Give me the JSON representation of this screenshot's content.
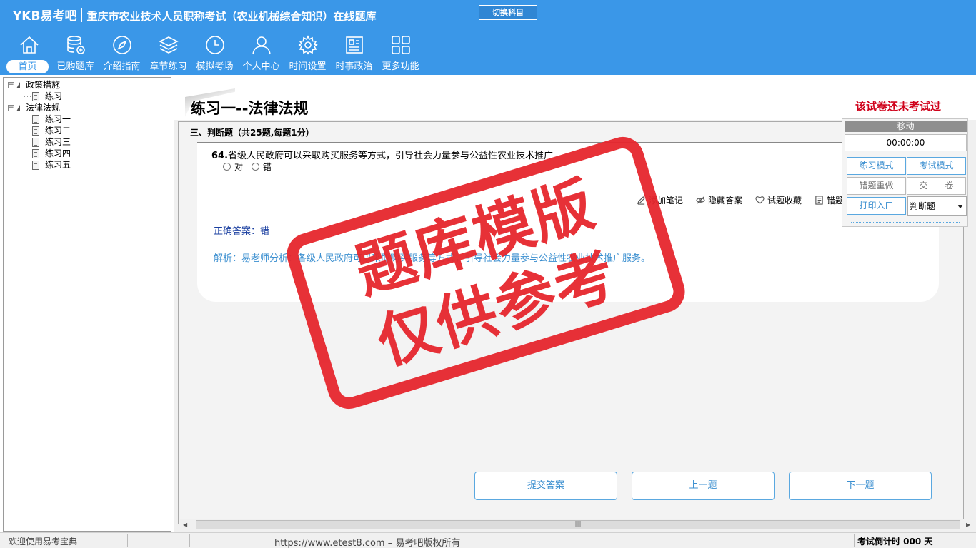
{
  "header": {
    "brand": "YKB易考吧",
    "title": "重庆市农业技术人员职称考试（农业机械综合知识）在线题库",
    "switch_label": "切换科目"
  },
  "nav": [
    {
      "label": "首页",
      "icon": "home-icon"
    },
    {
      "label": "已购题库",
      "icon": "database-icon"
    },
    {
      "label": "介绍指南",
      "icon": "compass-icon"
    },
    {
      "label": "章节练习",
      "icon": "layers-icon"
    },
    {
      "label": "模拟考场",
      "icon": "clock-icon"
    },
    {
      "label": "个人中心",
      "icon": "user-icon"
    },
    {
      "label": "时间设置",
      "icon": "gear-icon"
    },
    {
      "label": "时事政治",
      "icon": "news-icon"
    },
    {
      "label": "更多功能",
      "icon": "grid-icon"
    }
  ],
  "tree": {
    "groups": [
      {
        "label": "政策措施",
        "items": [
          "练习一"
        ]
      },
      {
        "label": "法律法规",
        "items": [
          "练习一",
          "练习二",
          "练习三",
          "练习四",
          "练习五"
        ]
      }
    ]
  },
  "main": {
    "heading": "练习一--法律法规",
    "exam_status": "该试卷还未考试过",
    "section_title": "三、判断题（共25题,每题1分）",
    "question": {
      "number": "64.",
      "text": "省级人民政府可以采取购买服务等方式，引导社会力量参与公益性农业技术推广",
      "options": [
        "对",
        "错"
      ],
      "tools": [
        "添加笔记",
        "隐藏答案",
        "试题收藏",
        "错题"
      ],
      "answer": "正确答案：错",
      "analysis": "解析：易老师分析：各级人民政府可以采取购买服务等方式，引导社会力量参与公益性农业技术推广服务。"
    },
    "buttons": {
      "submit": "提交答案",
      "prev": "上一题",
      "next": "下一题"
    }
  },
  "panel": {
    "move_label": "移动",
    "timer": "00:00:00",
    "practice_mode": "练习模式",
    "exam_mode": "考试模式",
    "redo_wrong": "错题重做",
    "hand_in": "交　　卷",
    "print": "打印入口",
    "type_select": "判断题"
  },
  "status": {
    "welcome": "欢迎使用易考宝典",
    "url": "https://www.etest8.com – 易考吧版权所有",
    "countdown": "考试倒计时 000 天"
  },
  "watermark": {
    "line1": "题库模版",
    "line2": "仅供参考"
  },
  "colors": {
    "header_bg": "#3a97e8",
    "stamp_red": "#e6262d",
    "answer_blue": "#1a3fa0",
    "accent_blue": "#3b8fd0"
  }
}
